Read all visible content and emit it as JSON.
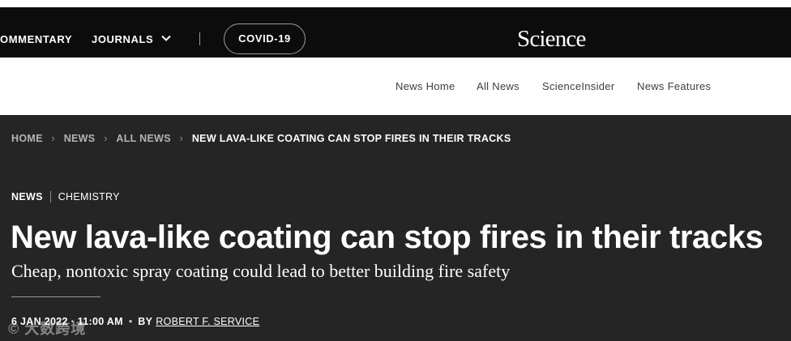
{
  "topnav": {
    "commentary": "OMMENTARY",
    "journals": "JOURNALS",
    "covid": "COVID-19",
    "logo": "Science"
  },
  "subnav": {
    "links": [
      "News Home",
      "All News",
      "ScienceInsider",
      "News Features"
    ]
  },
  "breadcrumb": {
    "items": [
      "HOME",
      "NEWS",
      "ALL NEWS"
    ],
    "current": "NEW LAVA-LIKE COATING CAN STOP FIRES IN THEIR TRACKS"
  },
  "article": {
    "section": "NEWS",
    "subject": "CHEMISTRY",
    "headline": "New lava-like coating can stop fires in their tracks",
    "dek": "Cheap, nontoxic spray coating could lead to better building fire safety",
    "date": "6 JAN 2022 · 11:00 AM",
    "by": "BY",
    "author": "ROBERT F. SERVICE"
  },
  "watermark": "© 大数跨境",
  "colors": {
    "topbar": "#0c0c0c",
    "page": "#252525",
    "subnav": "#ffffff"
  }
}
